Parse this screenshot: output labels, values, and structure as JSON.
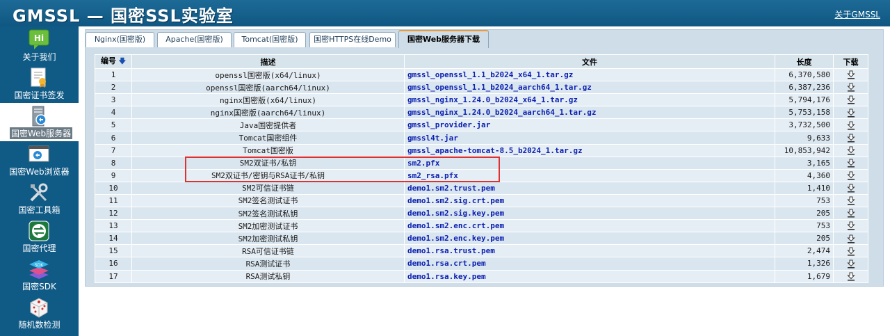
{
  "header": {
    "title": "GMSSL — 国密SSL实验室",
    "about_link": "关于GMSSL"
  },
  "sidebar": {
    "items": [
      {
        "label": "关于我们",
        "icon": "hi-icon"
      },
      {
        "label": "国密证书签发",
        "icon": "certificate-icon"
      },
      {
        "label": "国密Web服务器",
        "icon": "server-icon",
        "active": true
      },
      {
        "label": "国密Web浏览器",
        "icon": "browser-icon"
      },
      {
        "label": "国密工具箱",
        "icon": "tools-icon"
      },
      {
        "label": "国密代理",
        "icon": "proxy-icon"
      },
      {
        "label": "国密SDK",
        "icon": "sdk-icon"
      },
      {
        "label": "随机数检测",
        "icon": "dice-icon"
      }
    ]
  },
  "tabs": [
    {
      "label": "Nginx(国密版)"
    },
    {
      "label": "Apache(国密版)"
    },
    {
      "label": "Tomcat(国密版)"
    },
    {
      "label": "国密HTTPS在线Demo"
    },
    {
      "label": "国密Web服务器下载",
      "active": true
    }
  ],
  "table": {
    "headers": {
      "num": "编号",
      "desc": "描述",
      "file": "文件",
      "length": "长度",
      "download": "下载"
    },
    "rows": [
      {
        "num": "1",
        "desc": "openssl国密版(x64/linux)",
        "file": "gmssl_openssl_1.1_b2024_x64_1.tar.gz",
        "length": "6,370,580"
      },
      {
        "num": "2",
        "desc": "openssl国密版(aarch64/linux)",
        "file": "gmssl_openssl_1.1_b2024_aarch64_1.tar.gz",
        "length": "6,387,236"
      },
      {
        "num": "3",
        "desc": "nginx国密版(x64/linux)",
        "file": "gmssl_nginx_1.24.0_b2024_x64_1.tar.gz",
        "length": "5,794,176"
      },
      {
        "num": "4",
        "desc": "nginx国密版(aarch64/linux)",
        "file": "gmssl_nginx_1.24.0_b2024_aarch64_1.tar.gz",
        "length": "5,753,158"
      },
      {
        "num": "5",
        "desc": "Java国密提供者",
        "file": "gmssl_provider.jar",
        "length": "3,732,500"
      },
      {
        "num": "6",
        "desc": "Tomcat国密组件",
        "file": "gmssl4t.jar",
        "length": "9,633"
      },
      {
        "num": "7",
        "desc": "Tomcat国密版",
        "file": "gmssl_apache-tomcat-8.5_b2024_1.tar.gz",
        "length": "10,853,942"
      },
      {
        "num": "8",
        "desc": "SM2双证书/私钥",
        "file": "sm2.pfx",
        "length": "3,165"
      },
      {
        "num": "9",
        "desc": "SM2双证书/密钥与RSA证书/私钥",
        "file": "sm2_rsa.pfx",
        "length": "4,360"
      },
      {
        "num": "10",
        "desc": "SM2可信证书链",
        "file": "demo1.sm2.trust.pem",
        "length": "1,410"
      },
      {
        "num": "11",
        "desc": "SM2签名测试证书",
        "file": "demo1.sm2.sig.crt.pem",
        "length": "753"
      },
      {
        "num": "12",
        "desc": "SM2签名测试私钥",
        "file": "demo1.sm2.sig.key.pem",
        "length": "205"
      },
      {
        "num": "13",
        "desc": "SM2加密测试证书",
        "file": "demo1.sm2.enc.crt.pem",
        "length": "753"
      },
      {
        "num": "14",
        "desc": "SM2加密测试私钥",
        "file": "demo1.sm2.enc.key.pem",
        "length": "205"
      },
      {
        "num": "15",
        "desc": "RSA可信证书链",
        "file": "demo1.rsa.trust.pem",
        "length": "2,474"
      },
      {
        "num": "16",
        "desc": "RSA测试证书",
        "file": "demo1.rsa.crt.pem",
        "length": "1,326"
      },
      {
        "num": "17",
        "desc": "RSA测试私钥",
        "file": "demo1.rsa.key.pem",
        "length": "1,679"
      }
    ]
  }
}
